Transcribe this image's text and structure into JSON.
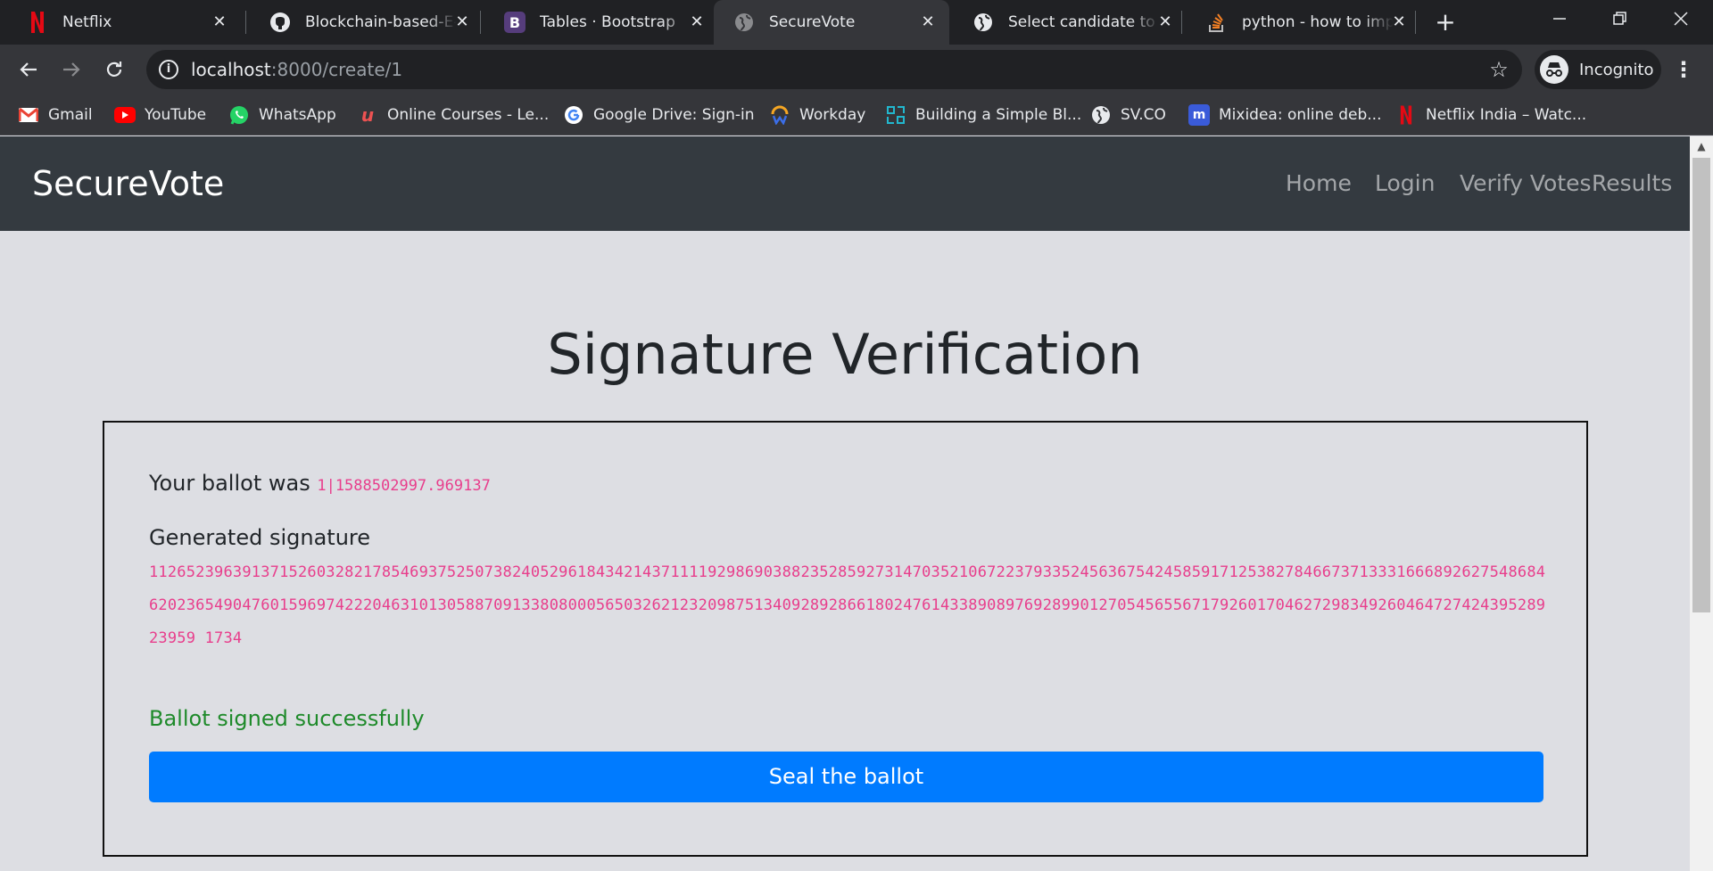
{
  "browser": {
    "tabs": [
      {
        "title": "Netflix",
        "icon": "netflix-icon",
        "active": false
      },
      {
        "title": "Blockchain-based-E-Vo",
        "icon": "github-icon",
        "active": false
      },
      {
        "title": "Tables · Bootstrap",
        "icon": "bootstrap-icon",
        "active": false
      },
      {
        "title": "SecureVote",
        "icon": "globe-icon",
        "active": true
      },
      {
        "title": "Select candidate to cast",
        "icon": "globe-icon",
        "active": false
      },
      {
        "title": "python - how to implem",
        "icon": "stackoverflow-icon",
        "active": false
      }
    ],
    "url_host": "localhost",
    "url_rest": ":8000/create/1",
    "incognito_label": "Incognito",
    "bookmarks": [
      {
        "label": "Gmail",
        "icon": "gmail-icon"
      },
      {
        "label": "YouTube",
        "icon": "youtube-icon"
      },
      {
        "label": "WhatsApp",
        "icon": "whatsapp-icon"
      },
      {
        "label": "Online Courses - Le...",
        "icon": "udemy-icon"
      },
      {
        "label": "Google Drive: Sign-in",
        "icon": "google-icon"
      },
      {
        "label": "Workday",
        "icon": "workday-icon"
      },
      {
        "label": "Building a Simple Bl...",
        "icon": "blockchain-icon"
      },
      {
        "label": "SV.CO",
        "icon": "globe-icon"
      },
      {
        "label": "Mixidea: online deb...",
        "icon": "mixidea-icon"
      },
      {
        "label": "Netflix India – Watc...",
        "icon": "netflix-icon"
      }
    ]
  },
  "site": {
    "brand": "SecureVote",
    "nav": [
      "Home",
      "Login",
      "Verify Votes",
      "Results"
    ]
  },
  "main": {
    "title": "Signature Verification",
    "ballot_prefix": "Your ballot was",
    "ballot_value": "1|1588502997.969137",
    "signature_label": "Generated signature",
    "signature_value": "11265239639137152603282178546937525073824052961843421437111192986903882352859273147035210672237933524563675424585917125382784667371333166689262754868462023654904760159697422204631013058870913380800056503262123209875134092892866180247614338908976928990127054565567179260170462729834926046472742439528923959 1734",
    "success_message": "Ballot signed successfully",
    "seal_button": "Seal the ballot"
  },
  "colors": {
    "navbar": "#343a40",
    "code": "#e83e8c",
    "success": "#1e8a2a",
    "primary": "#007bff"
  }
}
